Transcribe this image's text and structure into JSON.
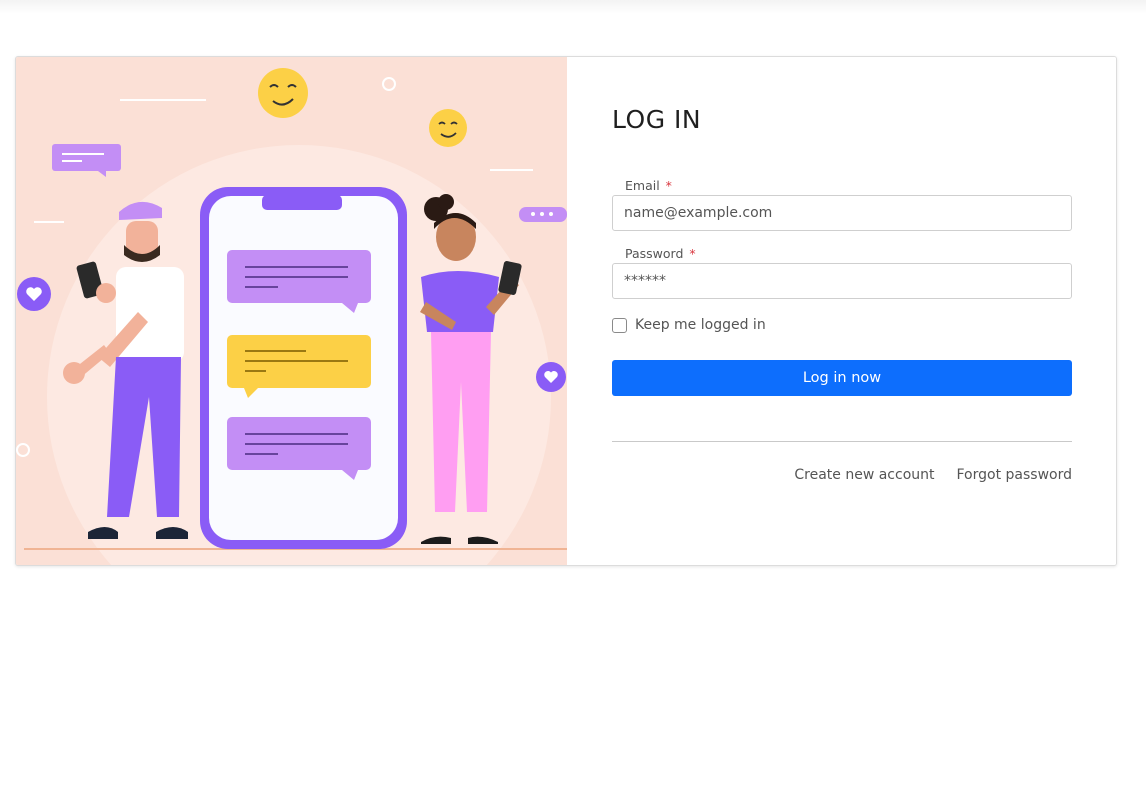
{
  "login": {
    "title": "LOG IN",
    "email": {
      "label": "Email",
      "required_mark": "*",
      "placeholder": "name@example.com"
    },
    "password": {
      "label": "Password",
      "required_mark": "*",
      "placeholder": "******"
    },
    "remember_label": "Keep me logged in",
    "remember_checked": false,
    "submit_label": "Log in now",
    "links": {
      "create_account": "Create new account",
      "forgot_password": "Forgot password"
    }
  },
  "colors": {
    "primary_button": "#0d6efd",
    "illustration_bg": "#fbe0d6",
    "required_mark": "#d9363e"
  },
  "illustration": {
    "subject": "two-people-chatting-on-phones",
    "icons": [
      "heart-icon",
      "smiley-emoji-icon",
      "chat-bubble-icon"
    ]
  }
}
